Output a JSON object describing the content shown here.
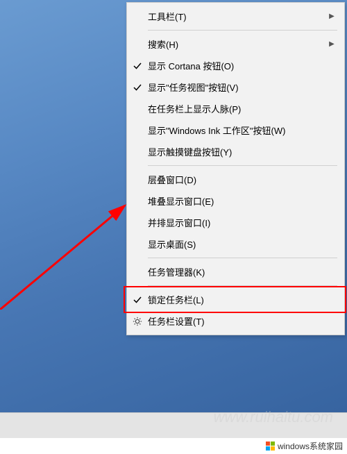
{
  "menu": {
    "items": [
      {
        "label": "工具栏(T)",
        "checked": false,
        "submenu": true,
        "icon": null
      },
      {
        "separator": true
      },
      {
        "label": "搜索(H)",
        "checked": false,
        "submenu": true,
        "icon": null
      },
      {
        "label": "显示 Cortana 按钮(O)",
        "checked": true,
        "submenu": false,
        "icon": null
      },
      {
        "label": "显示\"任务视图\"按钮(V)",
        "checked": true,
        "submenu": false,
        "icon": null
      },
      {
        "label": "在任务栏上显示人脉(P)",
        "checked": false,
        "submenu": false,
        "icon": null
      },
      {
        "label": "显示\"Windows Ink 工作区\"按钮(W)",
        "checked": false,
        "submenu": false,
        "icon": null
      },
      {
        "label": "显示触摸键盘按钮(Y)",
        "checked": false,
        "submenu": false,
        "icon": null
      },
      {
        "separator": true
      },
      {
        "label": "层叠窗口(D)",
        "checked": false,
        "submenu": false,
        "icon": null
      },
      {
        "label": "堆叠显示窗口(E)",
        "checked": false,
        "submenu": false,
        "icon": null
      },
      {
        "label": "并排显示窗口(I)",
        "checked": false,
        "submenu": false,
        "icon": null
      },
      {
        "label": "显示桌面(S)",
        "checked": false,
        "submenu": false,
        "icon": null
      },
      {
        "separator": true
      },
      {
        "label": "任务管理器(K)",
        "checked": false,
        "submenu": false,
        "icon": null
      },
      {
        "separator": true
      },
      {
        "label": "锁定任务栏(L)",
        "checked": true,
        "submenu": false,
        "icon": null,
        "highlighted": true
      },
      {
        "label": "任务栏设置(T)",
        "checked": false,
        "submenu": false,
        "icon": "gear"
      }
    ]
  },
  "watermark": {
    "text": "windows系统家园",
    "url": "www.ruihaitu.com"
  }
}
